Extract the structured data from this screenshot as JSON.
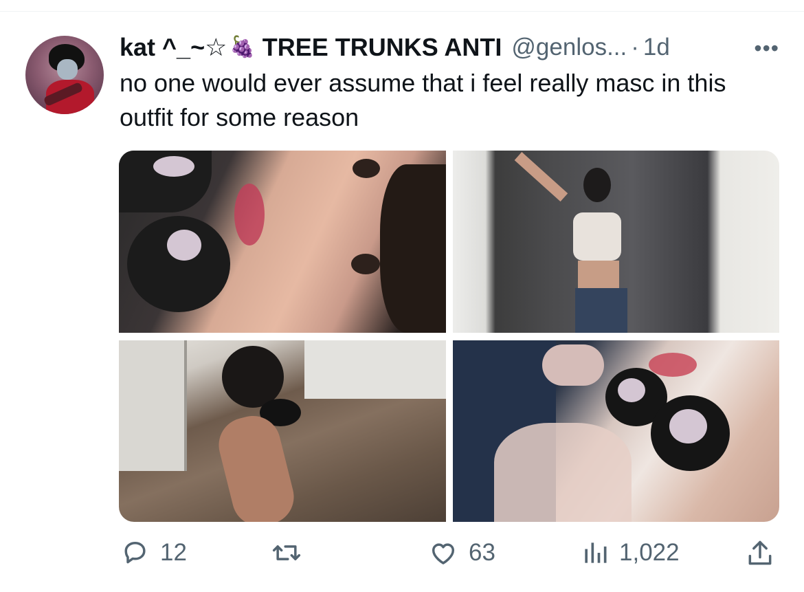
{
  "tweet": {
    "author": {
      "display_name_part1": "kat ^_~☆",
      "emoji": "🍇",
      "display_name_part2": "TREE TRUNKS ANTI",
      "handle": "@genlos...",
      "separator": "·",
      "time": "1d"
    },
    "more_label": "•••",
    "text": "no one would ever assume that i feel really masc in this outfit for some reason",
    "media_count": 4,
    "stats": {
      "replies": "12",
      "retweets": "",
      "likes": "63",
      "views": "1,022"
    }
  },
  "icons": {
    "reply": "reply-bubble-icon",
    "retweet": "retweet-icon",
    "like": "heart-icon",
    "views": "views-bar-chart-icon",
    "share": "share-upload-icon",
    "more": "more-dots-icon"
  },
  "colors": {
    "text_primary": "#0f1419",
    "text_secondary": "#536471",
    "divider": "#eff3f4"
  }
}
